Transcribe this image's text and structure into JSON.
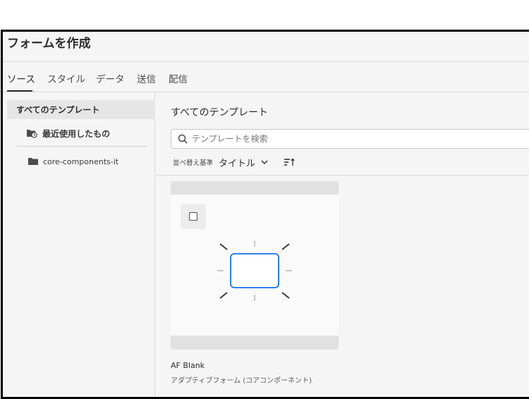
{
  "header": {
    "title": "フォームを作成"
  },
  "tabs": [
    {
      "label": "ソース",
      "active": true
    },
    {
      "label": "スタイル"
    },
    {
      "label": "データ"
    },
    {
      "label": "送信"
    },
    {
      "label": "配信"
    }
  ],
  "sidebar": {
    "items": [
      {
        "label": "すべてのテンプレート",
        "selected": true
      },
      {
        "label": "最近使用したもの",
        "icon": "folder-clock-icon"
      },
      {
        "label": "core-components-it",
        "icon": "folder-icon"
      }
    ]
  },
  "main": {
    "title": "すべてのテンプレート",
    "search": {
      "placeholder": "テンプレートを検索",
      "value": ""
    },
    "sort": {
      "label": "並べ替え基準",
      "value": "タイトル"
    },
    "cards": [
      {
        "name": "AF Blank",
        "subtitle": "アダプティブフォーム (コアコンポーネント)",
        "checked": false
      }
    ]
  },
  "colors": {
    "accent": "#1473e6",
    "selected_bg": "#e6e6e6"
  }
}
